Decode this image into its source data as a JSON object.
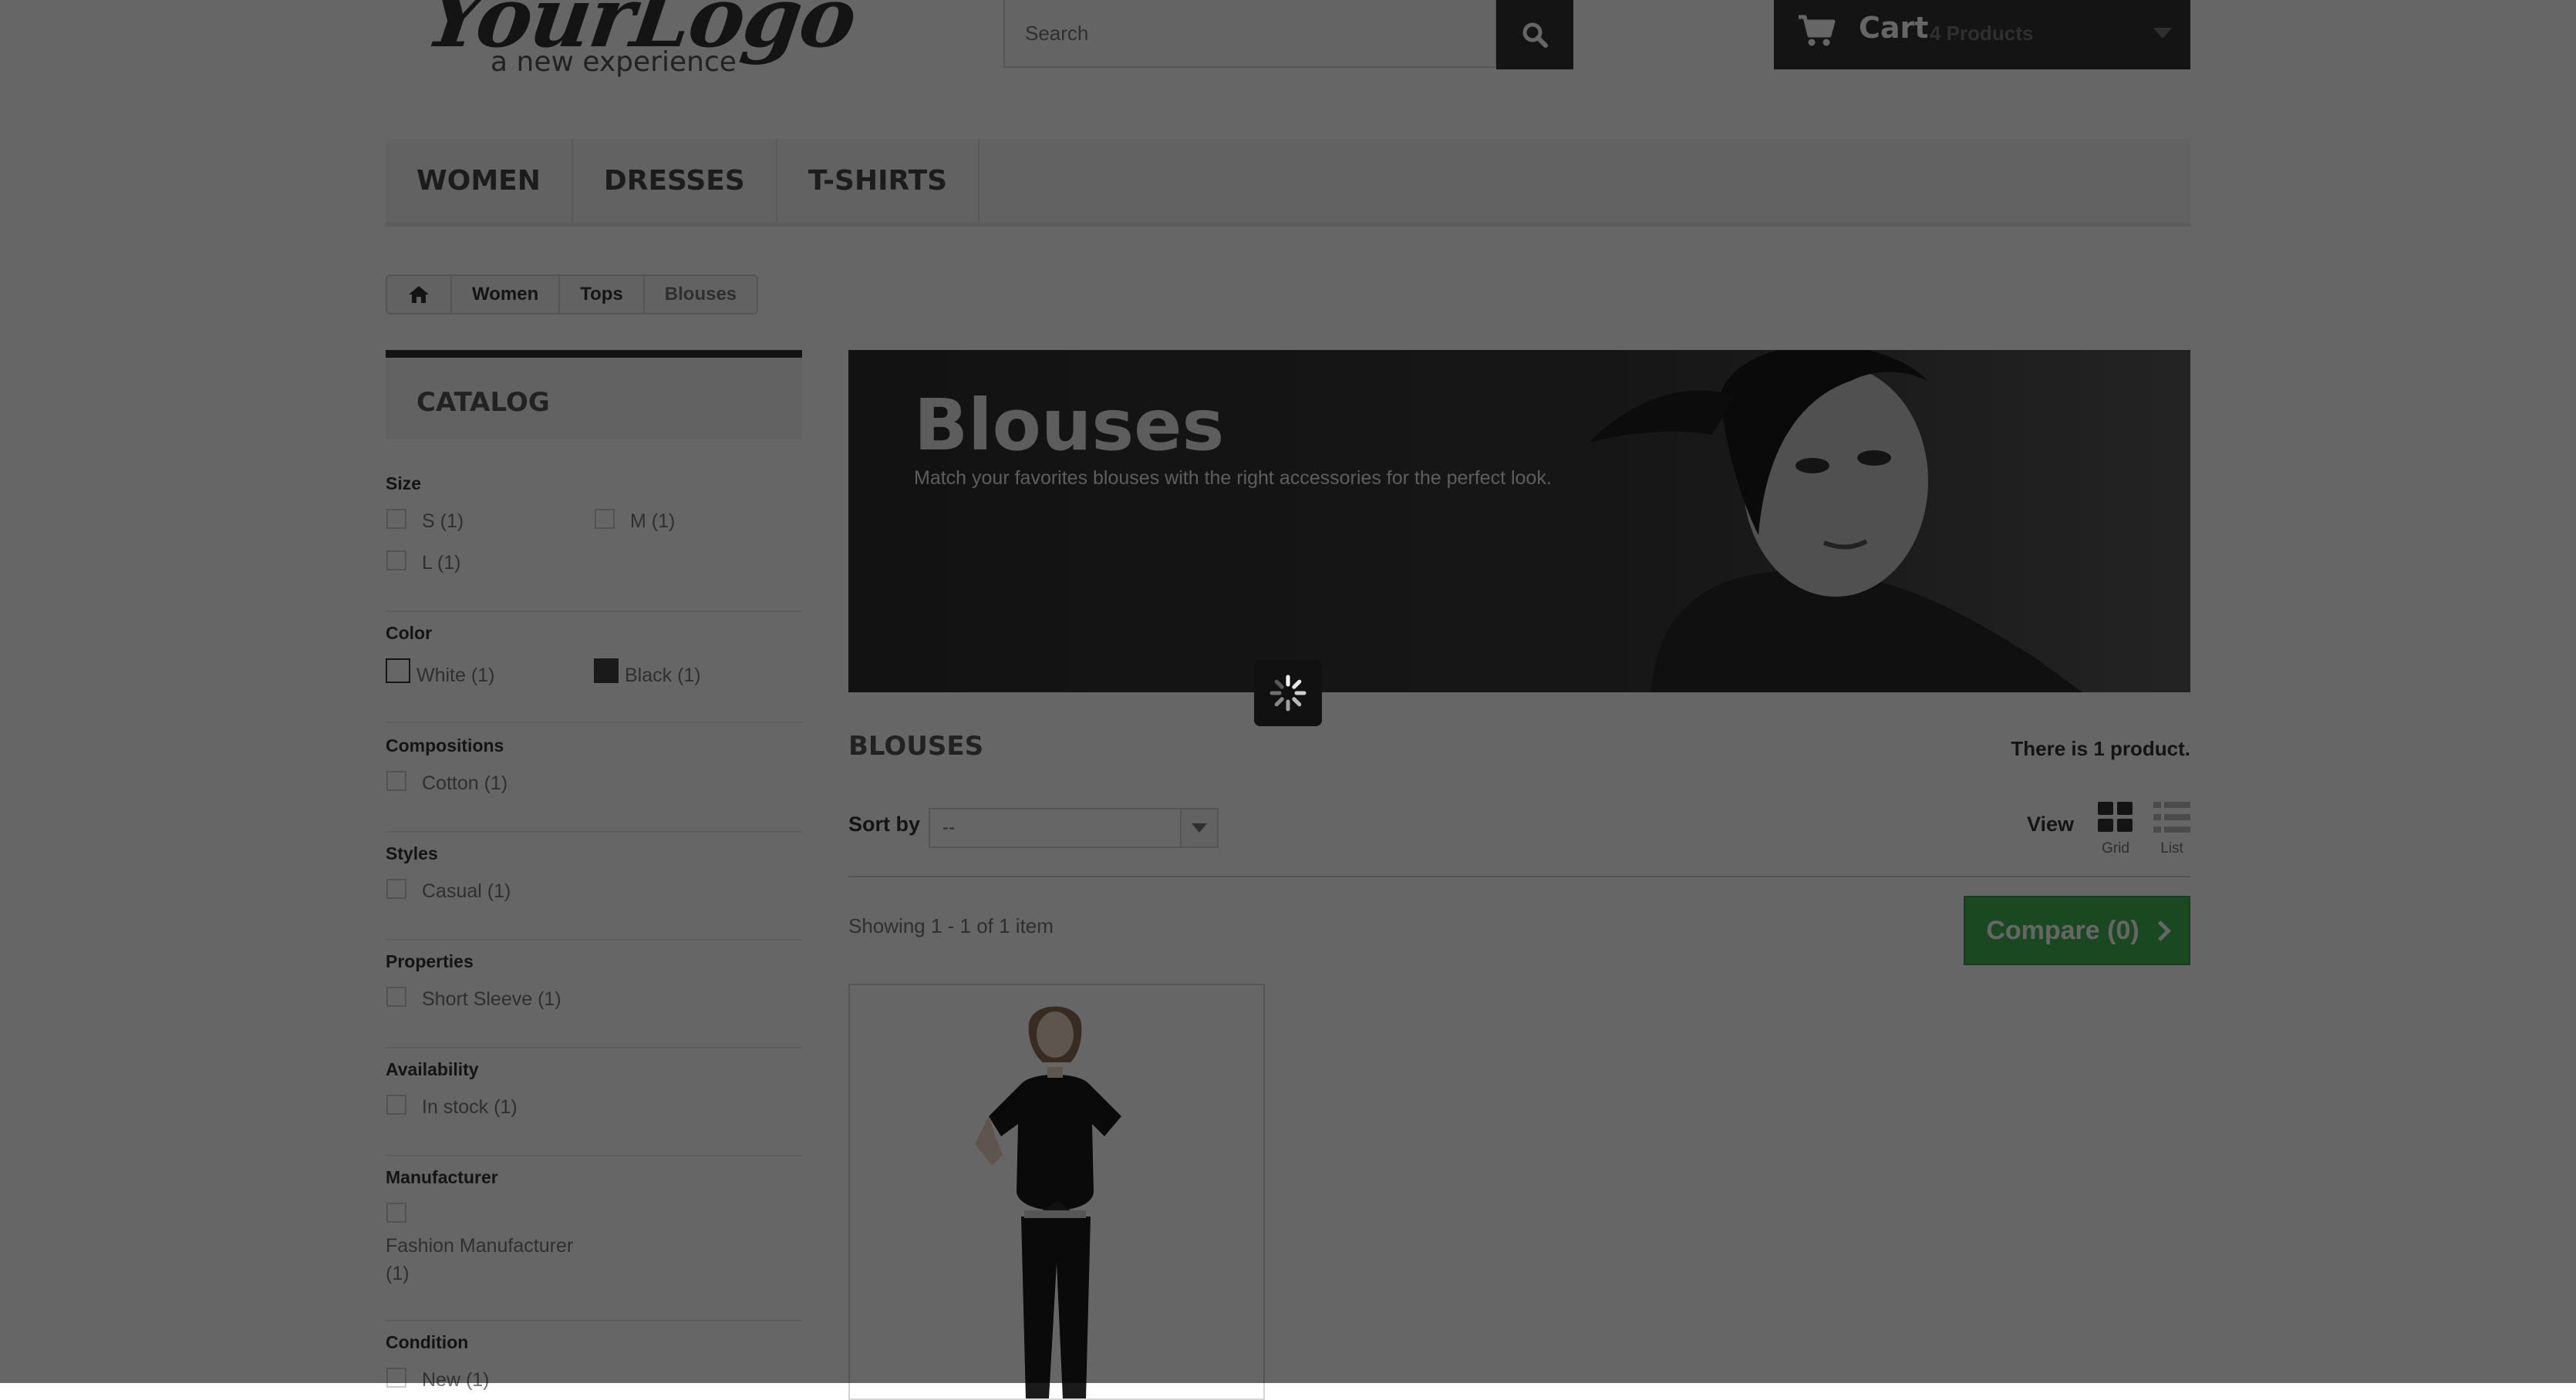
{
  "header": {
    "logo_main": "YourLogo",
    "logo_sub": "a new experience",
    "search_placeholder": "Search",
    "cart_label": "Cart",
    "cart_count": "4 Products"
  },
  "nav": {
    "items": [
      {
        "label": "WOMEN"
      },
      {
        "label": "DRESSES"
      },
      {
        "label": "T-SHIRTS"
      }
    ]
  },
  "breadcrumb": {
    "items": [
      "Women",
      "Tops",
      "Blouses"
    ]
  },
  "sidebar": {
    "catalog_title": "CATALOG",
    "filters": {
      "size": {
        "title": "Size",
        "options": [
          "S (1)",
          "M (1)",
          "L (1)"
        ]
      },
      "color": {
        "title": "Color",
        "options": [
          {
            "label": "White (1)",
            "swatch": "#ffffff"
          },
          {
            "label": "Black (1)",
            "swatch": "#434343"
          }
        ]
      },
      "compositions": {
        "title": "Compositions",
        "options": [
          "Cotton (1)"
        ]
      },
      "styles": {
        "title": "Styles",
        "options": [
          "Casual (1)"
        ]
      },
      "properties": {
        "title": "Properties",
        "options": [
          "Short Sleeve (1)"
        ]
      },
      "availability": {
        "title": "Availability",
        "options": [
          "In stock (1)"
        ]
      },
      "manufacturer": {
        "title": "Manufacturer",
        "options": [
          "Fashion Manufacturer",
          "(1)"
        ]
      },
      "condition": {
        "title": "Condition",
        "options": [
          "New (1)"
        ]
      }
    }
  },
  "category": {
    "banner_title": "Blouses",
    "banner_subtitle": "Match your favorites blouses with the right accessories for the perfect look.",
    "heading": "BLOUSES",
    "product_count": "There is 1 product.",
    "sort_label": "Sort by",
    "sort_value": "--",
    "view_label": "View",
    "view_grid": "Grid",
    "view_list": "List",
    "showing": "Showing 1 - 1 of 1 item",
    "compare_label": "Compare (0)"
  },
  "colors": {
    "dark": "#333333",
    "compare_green": "#43b754",
    "overlay": "rgba(0,0,0,0.6)"
  },
  "icons": {
    "search": "search-icon",
    "cart": "cart-icon",
    "home": "home-icon",
    "grid": "grid-view-icon",
    "list": "list-view-icon",
    "loading": "loading-spinner-icon"
  }
}
